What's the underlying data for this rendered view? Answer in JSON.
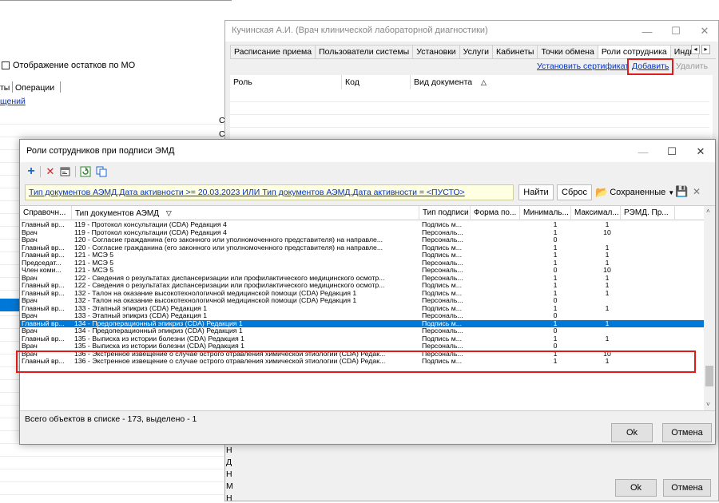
{
  "background_window": {
    "checkbox_label": "Отображение остатков по МО",
    "tab_fragment_1": "ты",
    "tab_fragment_2": "Операции",
    "link_fragment": "щений",
    "col_fragment": "С"
  },
  "right_dialog": {
    "title": "Кучинская А.И. (Врач клинической лабораторной диагностики)",
    "tabs": [
      "Расписание приема",
      "Пользователи системы",
      "Установки",
      "Услуги",
      "Кабинеты",
      "Точки обмена",
      "Роли сотрудника",
      "Индивид"
    ],
    "actions": {
      "set_certificate": "Установить сертификат",
      "add": "Добавить",
      "delete": "Удалить"
    },
    "columns": [
      "Роль",
      "Код",
      "Вид документа"
    ],
    "ok": "Ok",
    "cancel": "Отмена",
    "left_letters": [
      "Н",
      "Д",
      "Н",
      "М",
      "Н"
    ]
  },
  "modal": {
    "title": "Роли сотрудников при подписи ЭМД",
    "filter": "Тип документов АЭМД.Дата активности >= 20.03.2023 ИЛИ Тип документов АЭМД.Дата активности = <ПУСТО>",
    "find": "Найти",
    "reset": "Сброс",
    "saved": "Сохраненные",
    "columns": [
      "Справочн...",
      "Тип документов АЭМД",
      "Тип подписи",
      "Форма по...",
      "Минималь...",
      "Максимал...",
      "РЭМД. Пр..."
    ],
    "rows": [
      [
        "Главный вр...",
        "119 - Протокол консультации (CDA) Редакция 4",
        "Подпись м...",
        "",
        "1",
        "1"
      ],
      [
        "Врач",
        "119 - Протокол консультации (CDA) Редакция 4",
        "Персональ...",
        "",
        "1",
        "10"
      ],
      [
        "Врач",
        "120 - Согласие гражданина (его законного или уполномоченного представителя) на направле...",
        "Персональ...",
        "",
        "0",
        ""
      ],
      [
        "Главный вр...",
        "120 - Согласие гражданина (его законного или уполномоченного представителя) на направле...",
        "Подпись м...",
        "",
        "1",
        "1"
      ],
      [
        "Главный вр...",
        "121 - МСЭ 5",
        "Подпись м...",
        "",
        "1",
        "1"
      ],
      [
        "Председат...",
        "121 - МСЭ 5",
        "Персональ...",
        "",
        "1",
        "1"
      ],
      [
        "Член коми...",
        "121 - МСЭ 5",
        "Персональ...",
        "",
        "0",
        "10"
      ],
      [
        "Врач",
        "122 - Сведения о результатах диспансеризации или профилактического медицинского осмотр...",
        "Персональ...",
        "",
        "1",
        "1"
      ],
      [
        "Главный вр...",
        "122 - Сведения о результатах диспансеризации или профилактического медицинского осмотр...",
        "Подпись м...",
        "",
        "1",
        "1"
      ],
      [
        "Главный вр...",
        "132 - Талон на оказание высокотехнологичной медицинской помощи (CDA) Редакция 1",
        "Подпись м...",
        "",
        "1",
        "1"
      ],
      [
        "Врач",
        "132 - Талон на оказание высокотехнологичной медицинской помощи (CDA) Редакция 1",
        "Персональ...",
        "",
        "0",
        ""
      ],
      [
        "Главный вр...",
        "133 - Этапный эпикриз (CDA) Редакция 1",
        "Подпись м...",
        "",
        "1",
        "1"
      ],
      [
        "Врач",
        "133 - Этапный эпикриз (CDA) Редакция 1",
        "Персональ...",
        "",
        "0",
        ""
      ],
      [
        "Главный вр...",
        "134 - Предоперационный эпикриз (CDA) Редакция 1",
        "Подпись м...",
        "",
        "1",
        "1"
      ],
      [
        "Врач",
        "134 - Предоперационный эпикриз (CDA) Редакция 1",
        "Персональ...",
        "",
        "0",
        ""
      ],
      [
        "Главный вр...",
        "135 - Выписка из истории болезни (CDA) Редакция 1",
        "Подпись м...",
        "",
        "1",
        "1"
      ],
      [
        "Врач",
        "135 - Выписка из истории болезни (CDA) Редакция 1",
        "Персональ...",
        "",
        "0",
        ""
      ],
      [
        "Врач",
        "136 - Экстренное извещение о случае острого отравления химической этиологии (CDA) Редак...",
        "Персональ...",
        "",
        "1",
        "10"
      ],
      [
        "Главный вр...",
        "136 - Экстренное извещение о случае острого отравления химической этиологии (CDA) Редак...",
        "Подпись м...",
        "",
        "1",
        "1"
      ]
    ],
    "selected_row": 13,
    "status": "Всего объектов в списке - 173, выделено - 1",
    "ok": "Ok",
    "cancel": "Отмена"
  },
  "colors": {
    "accent": "#0078d7",
    "highlight": "#e01b1b",
    "filter_bg": "#ffffe1"
  }
}
